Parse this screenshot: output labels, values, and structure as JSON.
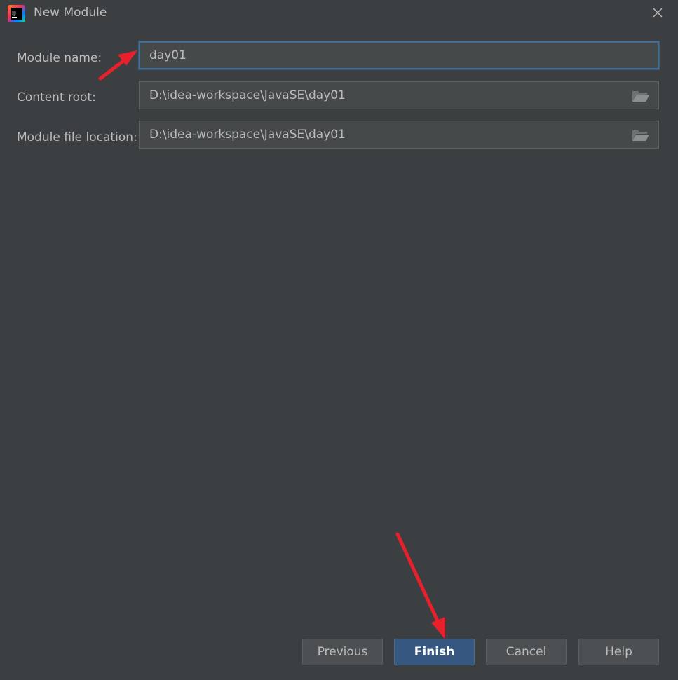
{
  "window": {
    "title": "New Module",
    "app_icon": "intellij-idea-icon",
    "close_icon": "close-icon"
  },
  "form": {
    "module_name": {
      "label": "Module name:",
      "value": "day01"
    },
    "content_root": {
      "label": "Content root:",
      "value": "D:\\idea-workspace\\JavaSE\\day01",
      "browse_icon": "folder-open-icon"
    },
    "module_file_location": {
      "label": "Module file location:",
      "value": "D:\\idea-workspace\\JavaSE\\day01",
      "browse_icon": "folder-open-icon"
    }
  },
  "buttons": {
    "previous": "Previous",
    "finish": "Finish",
    "cancel": "Cancel",
    "help": "Help"
  },
  "colors": {
    "background": "#3c3f41",
    "field_background": "#45494a",
    "focus_border": "#466d94",
    "primary_button": "#365880",
    "annotation_arrow": "#e8202b"
  }
}
